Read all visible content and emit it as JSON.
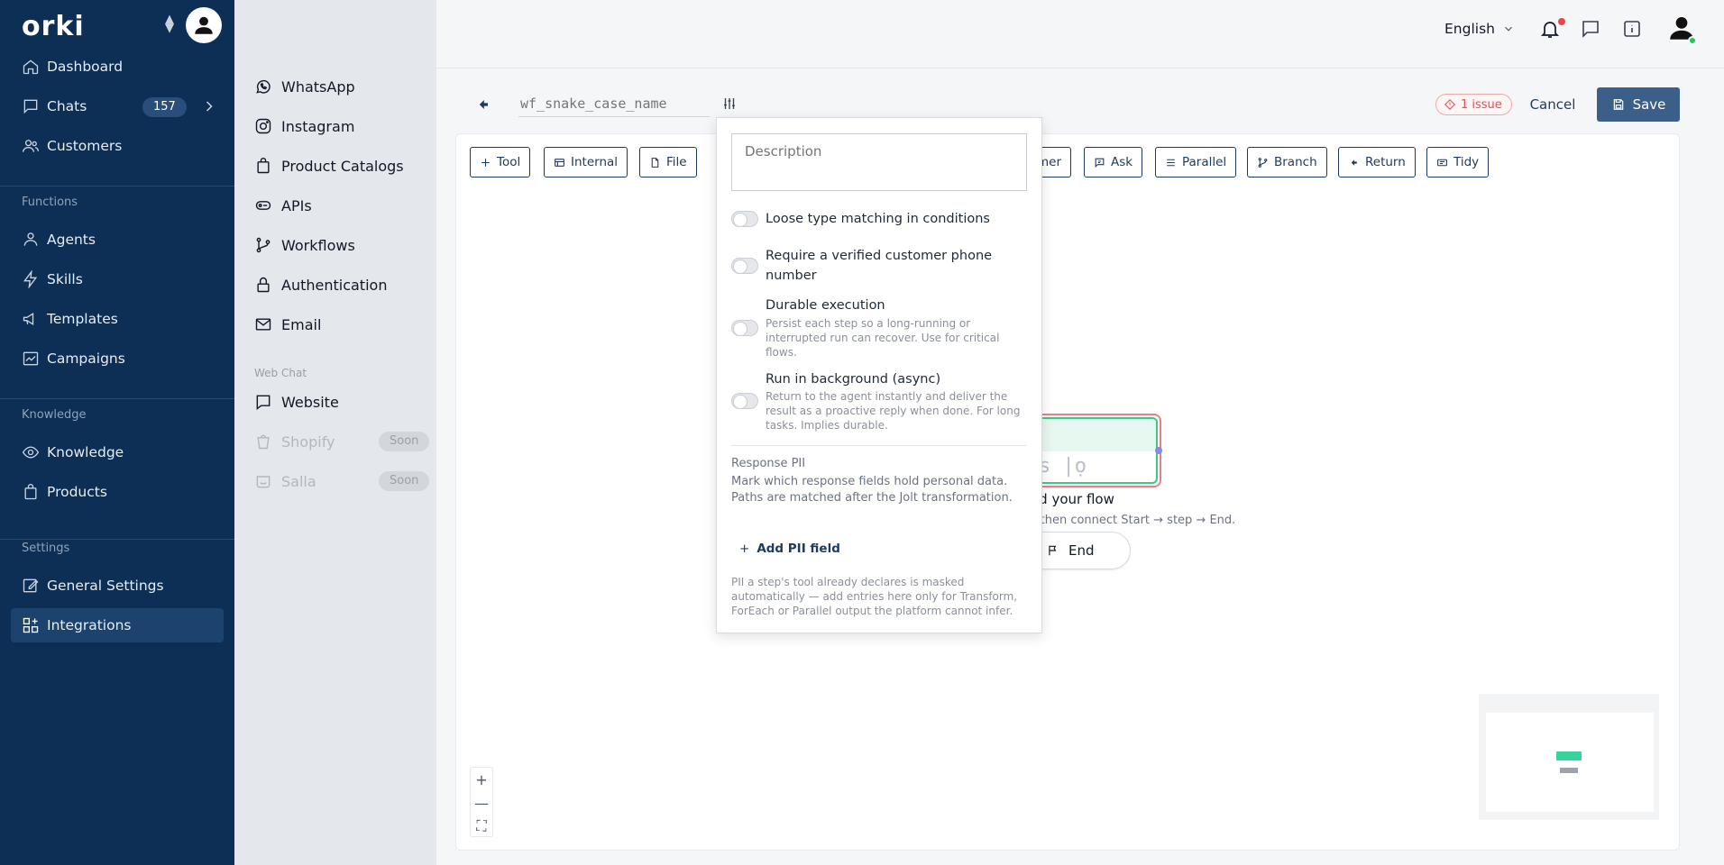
{
  "sidebar": {
    "brand": "orki",
    "nav_main": [
      {
        "label": "Dashboard",
        "icon": "home-icon"
      },
      {
        "label": "Chats",
        "icon": "chat-icon",
        "badge": "157"
      },
      {
        "label": "Customers",
        "icon": "users-icon"
      }
    ],
    "functions_label": "Functions",
    "nav_functions": [
      {
        "label": "Agents",
        "icon": "agent-icon"
      },
      {
        "label": "Skills",
        "icon": "bolt-icon"
      },
      {
        "label": "Templates",
        "icon": "megaphone-icon"
      },
      {
        "label": "Campaigns",
        "icon": "chart-icon"
      }
    ],
    "knowledge_label": "Knowledge",
    "nav_knowledge": [
      {
        "label": "Knowledge",
        "icon": "eye-icon"
      },
      {
        "label": "Products",
        "icon": "bag-icon"
      }
    ],
    "settings_label": "Settings",
    "nav_settings": [
      {
        "label": "General Settings",
        "icon": "edit-icon"
      },
      {
        "label": "Integrations",
        "icon": "grid-plus-icon"
      }
    ]
  },
  "subnav": {
    "items": [
      {
        "label": "WhatsApp"
      },
      {
        "label": "Instagram"
      },
      {
        "label": "Product Catalogs"
      },
      {
        "label": "APIs"
      },
      {
        "label": "Workflows"
      },
      {
        "label": "Authentication"
      },
      {
        "label": "Email"
      }
    ],
    "webchat_label": "Web Chat",
    "webchat_items": [
      {
        "label": "Website"
      },
      {
        "label": "Shopify",
        "soon": "Soon"
      },
      {
        "label": "Salla",
        "soon": "Soon"
      }
    ]
  },
  "topbar": {
    "language": "English"
  },
  "editor": {
    "name_placeholder": "wf_snake_case_name",
    "issue": "1 issue",
    "cancel": "Cancel",
    "save": "Save",
    "toolbar": [
      "Tool",
      "Internal",
      "File",
      "mer",
      "Ask",
      "Parallel",
      "Branch",
      "Return",
      "Tidy"
    ]
  },
  "canvas": {
    "node_colon": ":",
    "node_glyph": "s |ọ",
    "title": "ld your flow",
    "subtitle": "r, then connect Start → step → End.",
    "end_label": "End"
  },
  "popover": {
    "description_placeholder": "Description",
    "options": [
      {
        "label": "Loose type matching in conditions",
        "help": ""
      },
      {
        "label": "Require a verified customer phone number",
        "help": ""
      },
      {
        "label": "Durable execution",
        "help": "Persist each step so a long-running or interrupted run can recover. Use for critical flows."
      },
      {
        "label": "Run in background (async)",
        "help": "Return to the agent instantly and deliver the result as a proactive reply when done. For long tasks. Implies durable."
      }
    ],
    "pii_title": "Response PII",
    "pii_desc": "Mark which response fields hold personal data. Paths are matched after the Jolt transformation.",
    "add_pii": "Add PII field",
    "pii_note": "PII a step's tool already declares is masked automatically — add entries here only for Transform, ForEach or Parallel output the platform cannot infer."
  },
  "colors": {
    "sidebar_bg": "#0d2f55",
    "primary": "#3b5f89",
    "node_border": "#38c98d",
    "issue": "#e05252"
  }
}
